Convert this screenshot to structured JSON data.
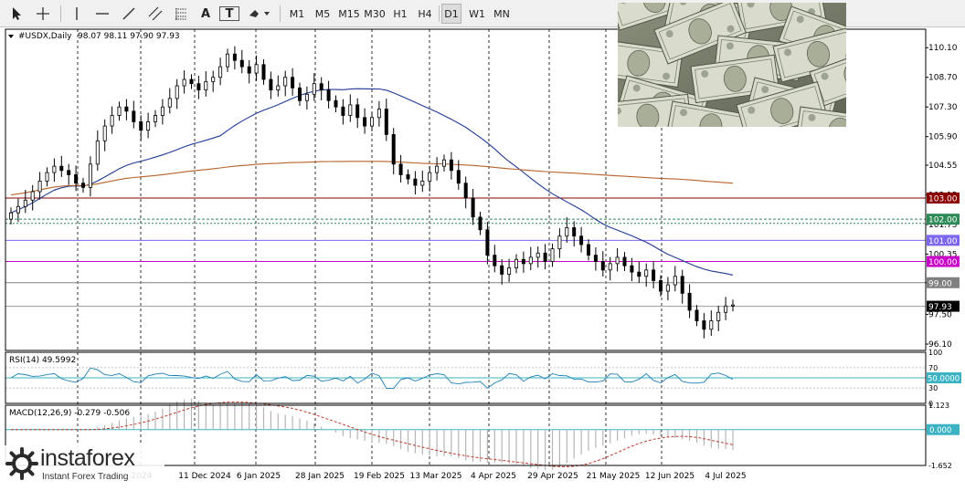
{
  "toolbar": {
    "timeframes": [
      "M1",
      "M5",
      "M15",
      "M30",
      "H1",
      "H4",
      "D1",
      "W1",
      "MN"
    ],
    "active_timeframe": "D1",
    "tools": [
      {
        "name": "cursor-icon"
      },
      {
        "name": "crosshair-icon"
      },
      {
        "name": "vertical-line-icon"
      },
      {
        "name": "horizontal-line-icon"
      },
      {
        "name": "trend-line-icon"
      },
      {
        "name": "equidistant-channel-icon"
      },
      {
        "name": "fibonacci-icon"
      },
      {
        "name": "text-icon",
        "label": "A"
      },
      {
        "name": "text-label-icon",
        "label": "T"
      },
      {
        "name": "shapes-icon"
      }
    ]
  },
  "chart_data": [
    {
      "type": "candlestick",
      "symbol_label": "#USDX,Daily",
      "ohlc_label": "98.07 98.11 97.90 97.93",
      "y_ticks": [
        "110.10",
        "108.70",
        "107.30",
        "105.90",
        "104.55",
        "103.15",
        "101.75",
        "100.35",
        "99.00",
        "97.50",
        "96.10"
      ],
      "x_ticks": [
        "2024",
        "11 Dec 2024",
        "6 Jan 2025",
        "28 Jan 2025",
        "19 Feb 2025",
        "13 Mar 2025",
        "4 Apr 2025",
        "29 Apr 2025",
        "21 May 2025",
        "12 Jun 2025",
        "4 Jul 2025"
      ],
      "ylim": [
        95.8,
        110.8
      ],
      "current_price": "97.93",
      "horizontal_levels": [
        {
          "label": "103.00",
          "color": "#8b0000"
        },
        {
          "label": "102.00",
          "color": "#2e8b57"
        },
        {
          "label": "101.00",
          "color": "#7b68ee"
        },
        {
          "label": "100.00",
          "color": "#c800c8"
        },
        {
          "label": "99.00",
          "color": "#808080"
        }
      ],
      "close_series": [
        102.3,
        102.6,
        102.9,
        103.3,
        103.8,
        104.2,
        104.5,
        104.3,
        104.1,
        103.7,
        103.5,
        104.6,
        105.7,
        106.4,
        106.9,
        107.3,
        107.1,
        106.6,
        106.2,
        106.6,
        106.9,
        107.3,
        107.7,
        108.3,
        108.6,
        108.4,
        108.1,
        108.5,
        108.7,
        109.2,
        109.8,
        109.5,
        109.2,
        108.9,
        109.3,
        108.6,
        108.1,
        108.3,
        108.7,
        108.2,
        107.6,
        107.9,
        108.4,
        108.1,
        107.6,
        107.3,
        106.9,
        107.4,
        106.8,
        106.4,
        106.8,
        107.2,
        106.0,
        104.6,
        104.1,
        103.9,
        103.6,
        103.8,
        104.2,
        104.5,
        104.8,
        104.3,
        103.7,
        103.0,
        102.1,
        101.5,
        100.3,
        99.8,
        99.4,
        99.7,
        100.1,
        99.9,
        100.2,
        100.4,
        100.0,
        100.6,
        101.2,
        101.6,
        101.2,
        100.8,
        100.3,
        100.0,
        99.6,
        99.9,
        100.2,
        99.8,
        99.5,
        99.3,
        99.6,
        99.1,
        98.6,
        98.9,
        99.3,
        98.5,
        97.7,
        97.2,
        96.8,
        97.2,
        97.6,
        97.9,
        97.95
      ],
      "ma_fast": {
        "color": "#1f3a93"
      },
      "ma_slow": {
        "color": "#b8622b"
      },
      "rsi": {
        "label": "RSI(14) 49.5992",
        "levels": [
          "100",
          "70",
          "30",
          "0"
        ],
        "current_label": "50.0000"
      },
      "macd": {
        "label": "MACD(12,26,9) -0.279 -0.506",
        "levels": [
          "1.123",
          "0.000",
          "-1.652"
        ]
      }
    }
  ],
  "branding": {
    "logo_name": "instaforex",
    "logo_tagline": "Instant Forex Trading",
    "logo_icon": "instaforex-logo-icon"
  }
}
